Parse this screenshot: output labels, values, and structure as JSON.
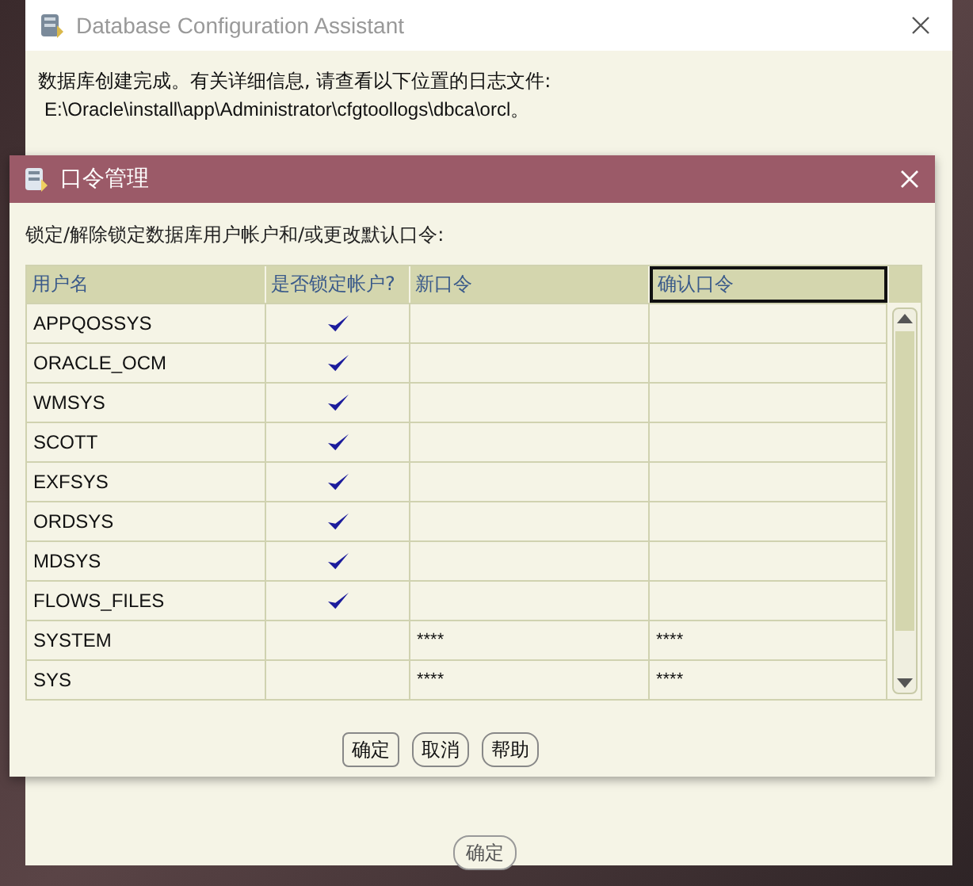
{
  "main_window": {
    "title": "Database Configuration Assistant",
    "message_lines": [
      "数据库创建完成。有关详细信息, 请查看以下位置的日志文件:",
      "E:\\Oracle\\install\\app\\Administrator\\cfgtoollogs\\dbca\\orcl。"
    ],
    "ok_button": "确定"
  },
  "dialog": {
    "title": "口令管理",
    "instruction": "锁定/解除锁定数据库用户帐户和/或更改默认口令:",
    "table": {
      "columns": [
        {
          "label": "用户名",
          "focused": false
        },
        {
          "label": "是否锁定帐户?",
          "focused": false
        },
        {
          "label": "新口令",
          "focused": false
        },
        {
          "label": "确认口令",
          "focused": true
        }
      ],
      "rows": [
        {
          "user": "APPQOSSYS",
          "locked": true
        },
        {
          "user": "ORACLE_OCM",
          "locked": true
        },
        {
          "user": "WMSYS",
          "locked": true
        },
        {
          "user": "SCOTT",
          "locked": true
        },
        {
          "user": "EXFSYS",
          "locked": true
        },
        {
          "user": "ORDSYS",
          "locked": true
        },
        {
          "user": "MDSYS",
          "locked": true
        },
        {
          "user": "FLOWS_FILES",
          "locked": true
        },
        {
          "user": "SYSTEM",
          "locked": false,
          "new_password": "****",
          "confirm_password": "****"
        },
        {
          "user": "SYS",
          "locked": false,
          "new_password": "****",
          "confirm_password": "****"
        }
      ]
    },
    "buttons": [
      "确定",
      "取消",
      "帮助"
    ]
  }
}
